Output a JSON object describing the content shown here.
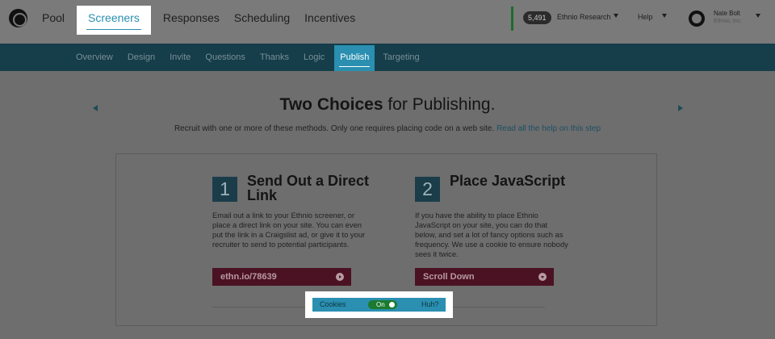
{
  "topnav": {
    "items": [
      {
        "label": "Pool"
      },
      {
        "label": "Screeners"
      },
      {
        "label": "Responses"
      },
      {
        "label": "Scheduling"
      },
      {
        "label": "Incentives"
      }
    ],
    "active_index": 1,
    "research_count": "5,491",
    "research_label": "Ethnio Research",
    "help_label": "Help",
    "user_name": "Nate Bolt",
    "user_org": "Ethnio, Inc."
  },
  "subnav": {
    "items": [
      {
        "label": "Overview"
      },
      {
        "label": "Design"
      },
      {
        "label": "Invite"
      },
      {
        "label": "Questions"
      },
      {
        "label": "Thanks"
      },
      {
        "label": "Logic"
      },
      {
        "label": "Publish"
      },
      {
        "label": "Targeting"
      }
    ],
    "active_index": 6
  },
  "headline": {
    "bold": "Two Choices",
    "rest": " for Publishing.",
    "subtext": "Recruit with one or more of these methods. Only one requires placing code on a web site.",
    "help_link": "Read all the help on this step"
  },
  "option1": {
    "number": "1",
    "title": "Send Out a Direct Link",
    "body": "Email out a link to your Ethnio screener, or place a direct link on your site. You can even put the link in a Craigslist ad, or give it to your recruiter to send to potential participants.",
    "button": "ethn.io/78639",
    "icon": "arrow-right-circle-icon"
  },
  "option2": {
    "number": "2",
    "title": "Place JavaScript",
    "body": "If you have the ability to place Ethnio JavaScript on your site, you can do that below, and set a lot of fancy options such as frequency. We use a cookie to ensure nobody sees it twice.",
    "button": "Scroll Down",
    "icon": "arrow-down-circle-icon"
  },
  "cookies": {
    "label": "Cookies",
    "toggle_label": "On",
    "toggle_on": true,
    "help": "Huh?"
  },
  "colors": {
    "accent": "#2a8fb0",
    "subnav_bg": "#153d4a",
    "cta_bg": "#4b1224",
    "toggle_on": "#1b7a2e"
  }
}
